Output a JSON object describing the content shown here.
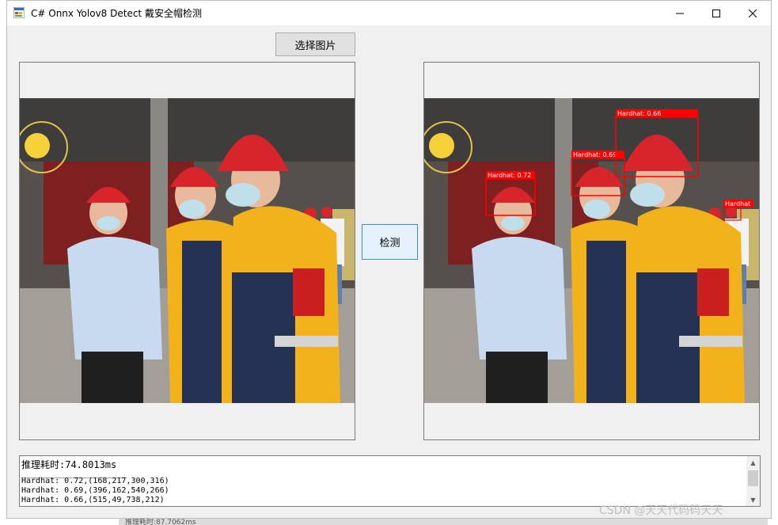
{
  "window": {
    "title": "C# Onnx Yolov8 Detect 戴安全帽检测"
  },
  "buttons": {
    "select_image": "选择图片",
    "detect": "检测"
  },
  "images": {
    "left": {
      "description": "source photo of workers wearing hardhats"
    },
    "right": {
      "detections": [
        {
          "label": "Hardhat: 0.72"
        },
        {
          "label": "Hardhat: 0.69"
        },
        {
          "label": "Hardhat: 0.66"
        },
        {
          "label": "Hardhat"
        }
      ]
    }
  },
  "output": {
    "line1": "推理耗时:74.8013ms",
    "rule": "______________________________",
    "lines": [
      "Hardhat: 0.72,(168,217,300,316)",
      "Hardhat: 0.69,(396,162,540,266)",
      "Hardhat: 0.66,(515,49,738,212)"
    ]
  },
  "watermark": "CSDN @天天代码码天天",
  "background_strip": "推理耗时:87.7062ms",
  "colors": {
    "hardhat_red": "#d8242b",
    "vest_yellow": "#f2b21c",
    "box_red": "#ff0000"
  }
}
